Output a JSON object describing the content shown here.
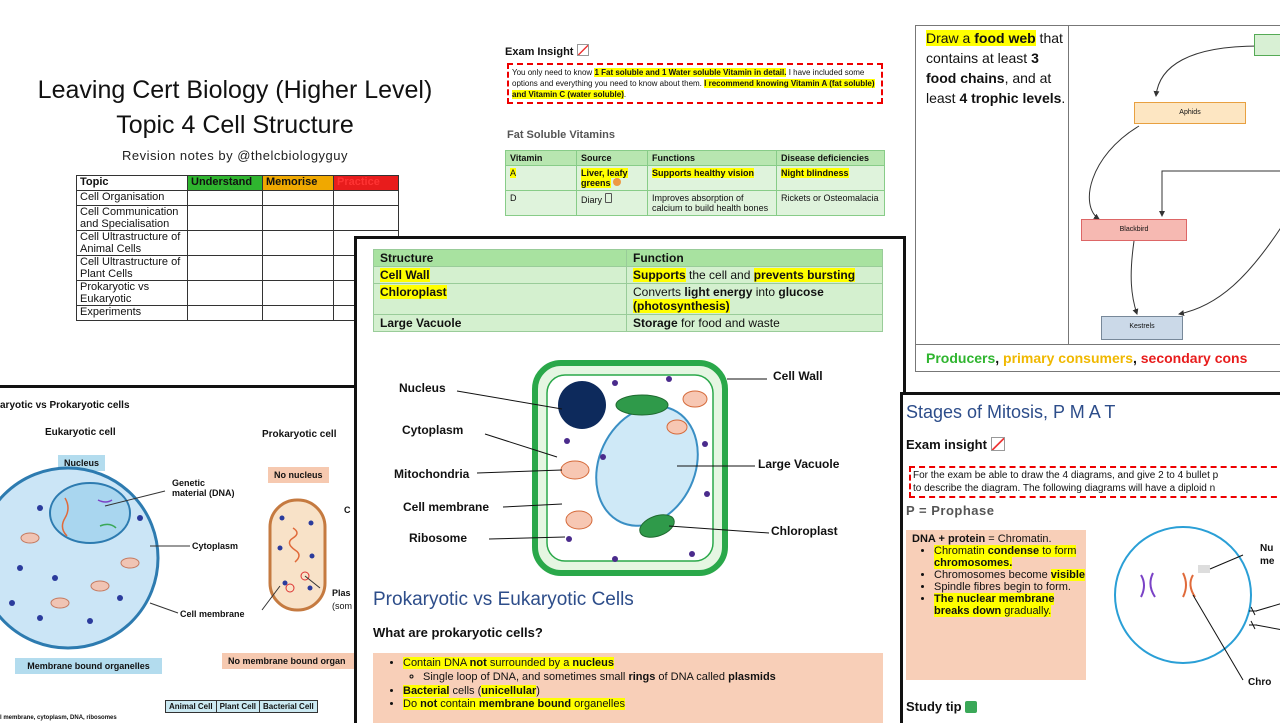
{
  "title_card": {
    "line1": "Leaving Cert Biology (Higher Level)",
    "line2": "Topic 4 Cell Structure",
    "byline": "Revision notes by @thelcbiologyguy",
    "headers": [
      "Topic",
      "Understand",
      "Memorise",
      "Practice"
    ],
    "header_colors": [
      "#ffffff",
      "#2fb52f",
      "#f0a800",
      "#e81c1c"
    ],
    "rows": [
      "Cell Organisation",
      "Cell Communication and Specialisation",
      "Cell Ultrastructure of Animal Cells",
      "Cell Ultrastructure of Plant Cells",
      "Prokaryotic vs Eukaryotic",
      "Experiments"
    ]
  },
  "vitamins": {
    "insight": "Exam Insight",
    "box_p1": "You only need to know ",
    "box_hl1": "1 Fat soluble and 1 Water soluble Vitamin in detail.",
    "box_p2": " I have included some options and everything you need to know about them. ",
    "box_hl2": "I recommend knowing Vitamin A (fat soluble) and Vitamin C (water soluble)",
    "box_p3": ".",
    "section": "Fat Soluble Vitamins",
    "headers": [
      "Vitamin",
      "Source",
      "Functions",
      "Disease deficiencies"
    ],
    "rows": [
      [
        "A",
        "Liver, leafy greens",
        "Supports healthy vision",
        "Night blindness"
      ],
      [
        "D",
        "Diary",
        "Improves absorption of calcium to build health bones",
        "Rickets or Osteomalacia"
      ]
    ]
  },
  "food_web": {
    "t1": "Draw a ",
    "t2": "food web",
    "t3": " that contains at least ",
    "t4": "3 food chains",
    "t5": ", and at least ",
    "t6": "4 trophic levels",
    "t7": ".",
    "nodes": {
      "aphids": "Aphids",
      "blackbird": "Blackbird",
      "kestrels": "Kestrels"
    },
    "f1": "Producers",
    "f2": ", ",
    "f3": "primary consumers",
    "f4": ", ",
    "f5": "secondary cons",
    "colors": {
      "producers": "#2fb52f",
      "primary": "#f0b800",
      "secondary": "#e81c1c"
    }
  },
  "euk_panel": {
    "title": "aryotic vs Prokaryotic cells",
    "euk": "Eukaryotic cell",
    "pro": "Prokaryotic cell",
    "nucleus": "Nucleus",
    "no_nucleus": "No nucleus",
    "genetic": "Genetic material (DNA)",
    "cytoplasm": "Cytoplasm",
    "membrane": "Cell membrane",
    "mbo": "Membrane bound organelles",
    "nmbo": "No membrane bound organ",
    "c_cut": "C",
    "plas": "Plas",
    "som": "(som",
    "table_headers": [
      "Animal Cell",
      "Plant Cell",
      "Bacterial Cell"
    ],
    "row_label": "l membrane, cytoplasm, DNA, ribosomes"
  },
  "center": {
    "headers": [
      "Structure",
      "Function"
    ],
    "rows": [
      {
        "s": "Cell Wall",
        "f1": "Supports",
        "f2": " the cell and ",
        "f3": "prevents bursting"
      },
      {
        "s": "Chloroplast",
        "f1": "Converts ",
        "f2": "light energy",
        "f3": " into ",
        "f4": "glucose",
        "f5": "(photosynthesis)"
      },
      {
        "s": "Large Vacuole",
        "f1": "Storage",
        "f2": " for food and waste"
      }
    ],
    "labels": {
      "nucleus": "Nucleus",
      "cytoplasm": "Cytoplasm",
      "mito": "Mitochondria",
      "membrane": "Cell membrane",
      "ribosome": "Ribosome",
      "wall": "Cell Wall",
      "vacuole": "Large Vacuole",
      "chloroplast": "Chloroplast"
    },
    "section_title": "Prokaryotic vs Eukaryotic Cells",
    "question": "What are prokaryotic cells?",
    "b1a": "Contain DNA ",
    "b1b": "not",
    "b1c": " surrounded by a ",
    "b1d": "nucleus",
    "b2a": "Single loop of DNA, and sometimes small ",
    "b2b": "rings",
    "b2c": " of DNA called ",
    "b2d": "plasmids",
    "b3a": "Bacterial",
    "b3b": " cells (",
    "b3c": "unicellular",
    "b3d": ")",
    "b4a": "Do ",
    "b4b": "not",
    "b4c": " contain ",
    "b4d": "membrane bound",
    "b4e": " organelles"
  },
  "mitosis": {
    "title": "Stages of Mitosis, P M A T",
    "insight": "Exam insight",
    "box1": "For the exam be able to draw the 4 diagrams, and give 2 to 4 bullet p",
    "box2": "to describe the diagram. The following diagrams will have a diploid n",
    "phase": "P = Prophase",
    "n0a": "DNA + protein",
    "n0b": " = Chromatin.",
    "n1a": "Chromatin ",
    "n1b": "condense",
    "n1c": " to form ",
    "n1d": "chromosomes.",
    "n2a": "Chromosomes become ",
    "n2b": "visible",
    "n3": "Spindle fibres begin to form.",
    "n4a": "The nuclear membrane breaks down",
    "n4b": " gradually.",
    "nu": "Nu",
    "me": "me",
    "chro": "Chro",
    "study": "Study tip"
  }
}
